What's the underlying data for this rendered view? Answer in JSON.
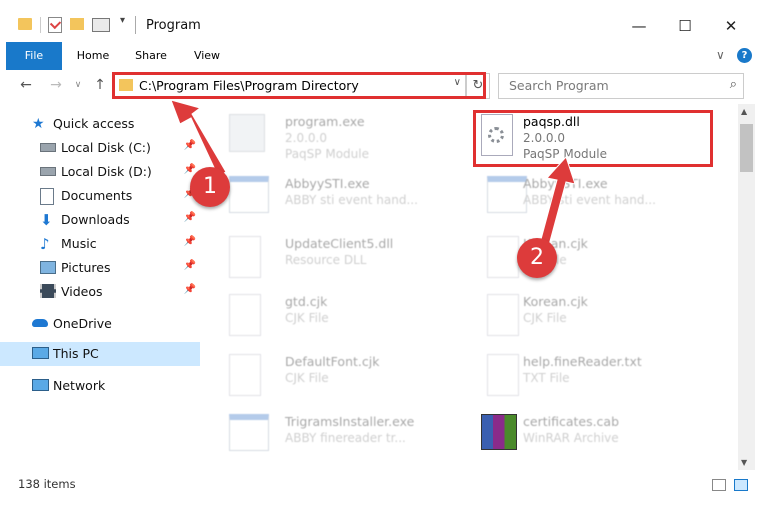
{
  "window": {
    "title": "Program",
    "controls": {
      "minimize": "—",
      "maximize": "☐",
      "close": "✕"
    }
  },
  "ribbon": {
    "tabs": [
      "File",
      "Home",
      "Share",
      "View"
    ],
    "help": "?",
    "collapse": "∨"
  },
  "nav": {
    "address": "C:\\Program Files\\Program Directory",
    "search_placeholder": "Search Program"
  },
  "sidebar": {
    "items": [
      {
        "label": "Quick access",
        "icon": "star-icon"
      },
      {
        "label": "Local Disk (C:)",
        "icon": "drive-icon"
      },
      {
        "label": "Local Disk (D:)",
        "icon": "drive-icon"
      },
      {
        "label": "Documents",
        "icon": "documents-icon"
      },
      {
        "label": "Downloads",
        "icon": "download-icon"
      },
      {
        "label": "Music",
        "icon": "music-icon"
      },
      {
        "label": "Pictures",
        "icon": "pictures-icon"
      },
      {
        "label": "Videos",
        "icon": "videos-icon"
      },
      {
        "label": "OneDrive",
        "icon": "cloud-icon"
      },
      {
        "label": "This PC",
        "icon": "computer-icon"
      },
      {
        "label": "Network",
        "icon": "network-icon"
      }
    ]
  },
  "files": [
    {
      "name": "program.exe",
      "line2": "2.0.0.0",
      "line3": "PaqSP Module"
    },
    {
      "name": "paqsp.dll",
      "line2": "2.0.0.0",
      "line3": "PaqSP Module"
    },
    {
      "name": "AbbyySTI.exe",
      "line2": "ABBY sti event hand..."
    },
    {
      "name": "AbbyySTI.exe",
      "line2": "ABBY sti event hand..."
    },
    {
      "name": "UpdateClient5.dll",
      "line2": "Resource DLL"
    },
    {
      "name": "Korean.cjk",
      "line2": "CJK File"
    },
    {
      "name": "gtd.cjk",
      "line2": "CJK File"
    },
    {
      "name": "Korean.cjk",
      "line2": "CJK File"
    },
    {
      "name": "DefaultFont.cjk",
      "line2": "CJK File"
    },
    {
      "name": "help.fineReader.txt",
      "line2": "TXT File"
    },
    {
      "name": "TrigramsInstaller.exe",
      "line2": "ABBY finereader tr..."
    },
    {
      "name": "certificates.cab",
      "line2": "WinRAR Archive"
    }
  ],
  "annotations": {
    "badge1": "1",
    "badge2": "2"
  },
  "status": {
    "items_count": "138 items"
  },
  "colors": {
    "accent": "#1979ca",
    "highlight": "#e03030",
    "selected": "#cce8ff"
  }
}
